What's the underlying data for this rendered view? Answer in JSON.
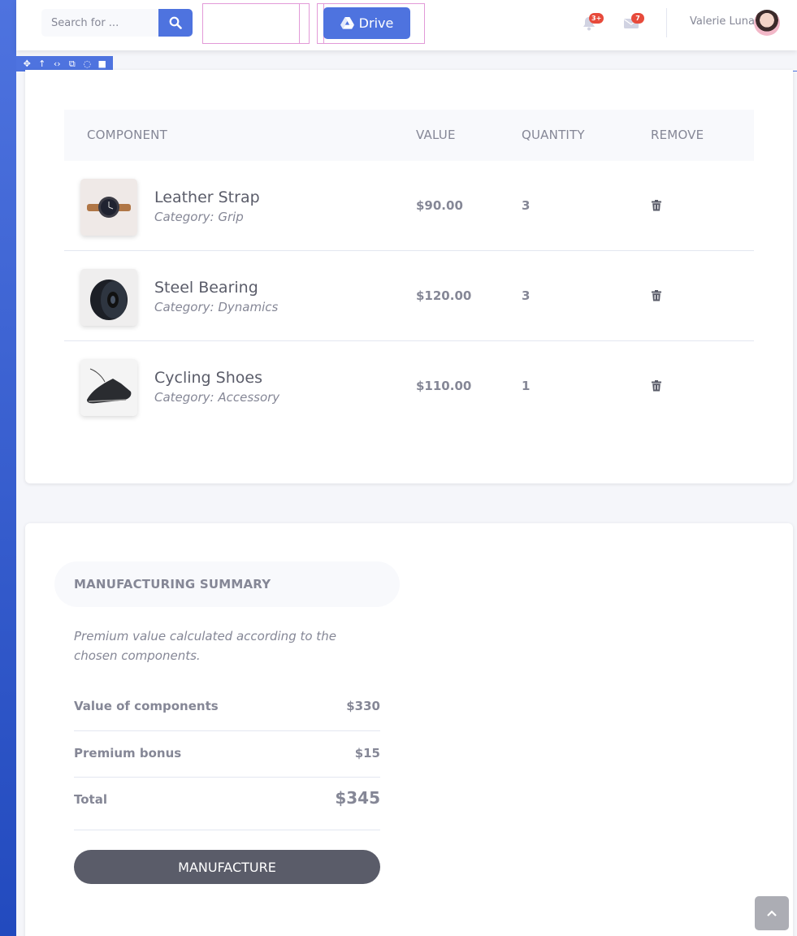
{
  "header": {
    "search_placeholder": "Search for ...",
    "drive_label": "Drive",
    "alerts_badge": "3+",
    "messages_badge": "7",
    "user_name": "Valerie Luna"
  },
  "table": {
    "columns": [
      "COMPONENT",
      "VALUE",
      "QUANTITY",
      "REMOVE"
    ],
    "rows": [
      {
        "name": "Leather Strap",
        "category": "Category: Grip",
        "value": "$90.00",
        "quantity": "3",
        "image": "watch"
      },
      {
        "name": "Steel Bearing",
        "category": "Category: Dynamics",
        "value": "$120.00",
        "quantity": "3",
        "image": "bearing"
      },
      {
        "name": "Cycling Shoes",
        "category": "Category: Accessory",
        "value": "$110.00",
        "quantity": "1",
        "image": "shoe"
      }
    ]
  },
  "summary": {
    "title": "MANUFACTURING SUMMARY",
    "description": "Premium value calculated according to the chosen components.",
    "lines": [
      {
        "label": "Value of components",
        "value": "$330"
      },
      {
        "label": "Premium bonus",
        "value": "$15"
      },
      {
        "label": "Total",
        "value": "$345"
      }
    ],
    "button_label": "MANUFACTURE"
  },
  "colors": {
    "primary": "#4e73df",
    "sidebar_start": "#4e73df",
    "sidebar_end": "#224abe",
    "danger": "#e74a3b",
    "dark_button": "#5a5c69",
    "builder_outline": "#e29ad8"
  }
}
